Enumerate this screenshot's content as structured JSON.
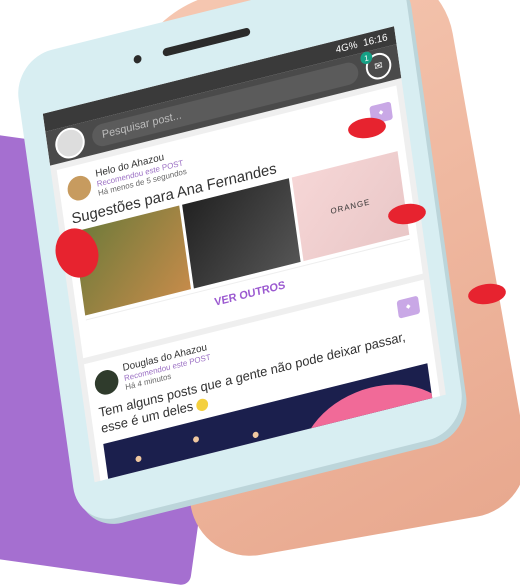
{
  "statusbar": {
    "signal": "4G%",
    "time": "16:16"
  },
  "topbar": {
    "search_placeholder": "Pesquisar post...",
    "notification_count": "1"
  },
  "card1": {
    "author_line": "Helo do Ahazou",
    "subtitle": "Recomendou este POST",
    "time": "Há menos de 5 segundos",
    "title": "Sugestões para Ana Fernandes",
    "sugg_brand": "ORANGE",
    "cta": "VER OUTROS"
  },
  "card2": {
    "author": "Douglas do Ahazou",
    "subtitle": "Recomendou este POST",
    "time": "Há 4 minutos",
    "text": "Tem alguns posts que a gente não pode deixar passar, esse é um deles"
  },
  "colors": {
    "accent": "#9b59d0",
    "nail": "#e7232f",
    "background_purple": "#a56fd0"
  }
}
